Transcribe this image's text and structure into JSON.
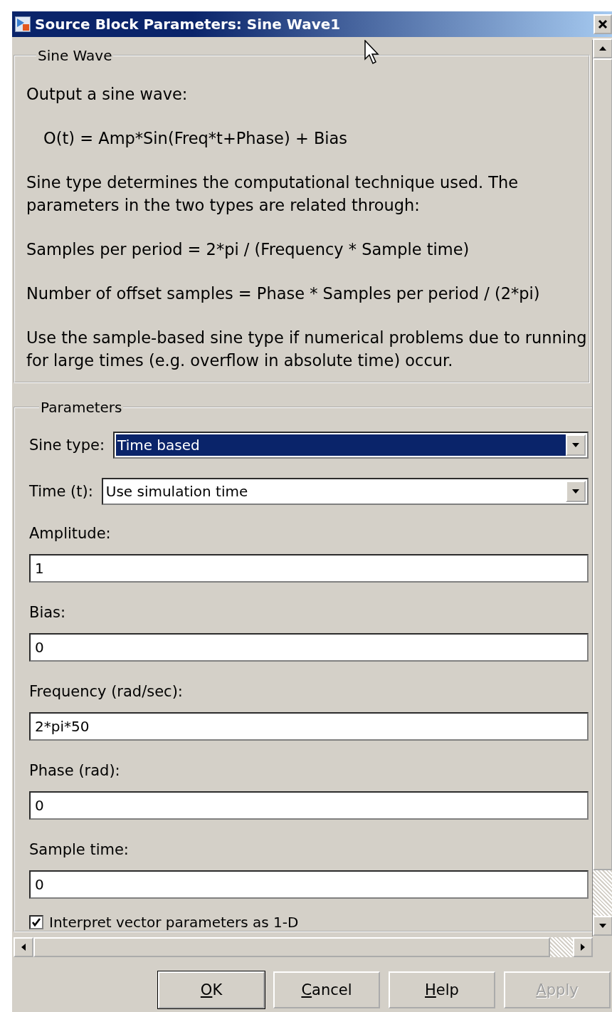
{
  "window": {
    "title": "Source Block Parameters: Sine Wave1"
  },
  "description": {
    "title": "Sine Wave",
    "paragraphs": [
      {
        "kind": "text",
        "lines": [
          "Output a sine wave:"
        ]
      },
      {
        "kind": "formula",
        "lines": [
          "O(t) = Amp*Sin(Freq*t+Phase) + Bias"
        ]
      },
      {
        "kind": "text",
        "lines": [
          "Sine type determines the computational technique used. The",
          "parameters in the two types are related through:"
        ]
      },
      {
        "kind": "text",
        "lines": [
          "Samples per period = 2*pi / (Frequency * Sample time)"
        ]
      },
      {
        "kind": "text",
        "lines": [
          "Number of offset samples = Phase * Samples per period / (2*pi)"
        ]
      },
      {
        "kind": "text",
        "lines": [
          "Use the sample-based sine type if numerical problems due to running",
          "for large times (e.g. overflow in absolute time) occur."
        ]
      }
    ]
  },
  "parameters": {
    "title": "Parameters",
    "fields": [
      {
        "kind": "dropdown",
        "label": "Sine type:",
        "value": "Time based",
        "focused": true
      },
      {
        "kind": "dropdown",
        "label": "Time (t):",
        "value": "Use simulation time",
        "focused": false
      },
      {
        "kind": "text",
        "label": "Amplitude:",
        "value": "1"
      },
      {
        "kind": "text",
        "label": "Bias:",
        "value": "0"
      },
      {
        "kind": "text",
        "label": "Frequency (rad/sec):",
        "value": "2*pi*50"
      },
      {
        "kind": "text",
        "label": "Phase (rad):",
        "value": "0"
      },
      {
        "kind": "text",
        "label": "Sample time:",
        "value": "0"
      },
      {
        "kind": "checkbox",
        "label": "Interpret vector parameters as 1-D",
        "checked": true
      }
    ]
  },
  "buttons": [
    {
      "key": "O",
      "rest": "K",
      "disabled": false
    },
    {
      "key": "C",
      "rest": "ancel",
      "disabled": false
    },
    {
      "key": "H",
      "rest": "elp",
      "disabled": false
    },
    {
      "key": "A",
      "rest": "pply",
      "disabled": true
    }
  ]
}
